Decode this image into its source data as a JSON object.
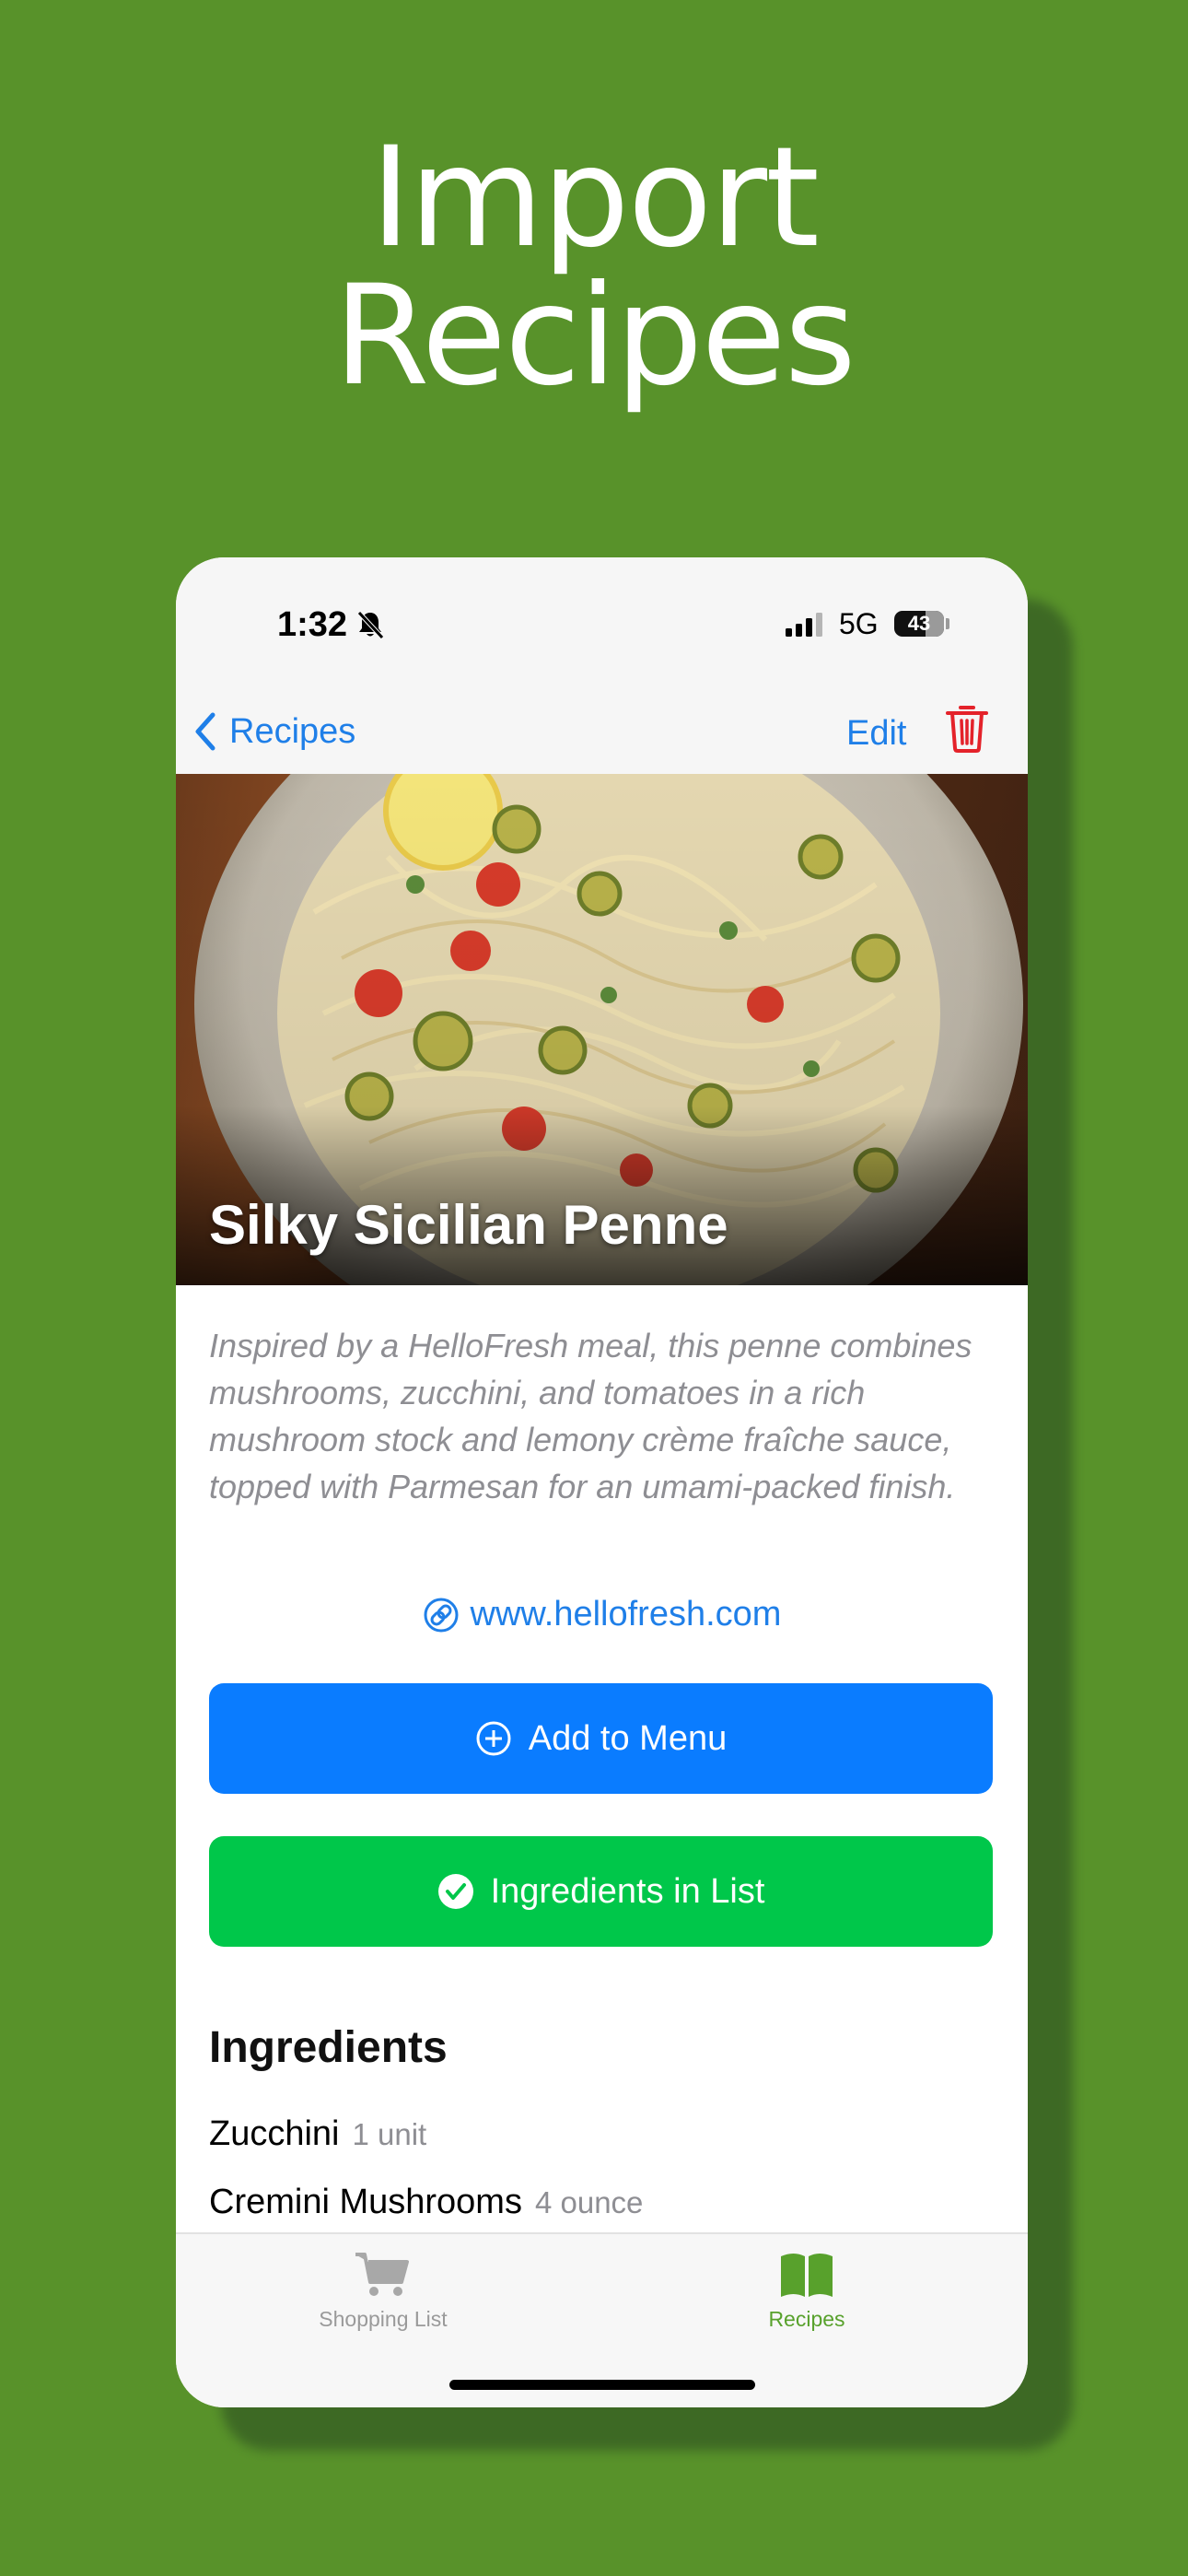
{
  "headline": {
    "line1": "Import",
    "line2": "Recipes"
  },
  "status": {
    "time": "1:32",
    "network": "5G",
    "battery": "43"
  },
  "nav": {
    "back_label": "Recipes",
    "edit_label": "Edit"
  },
  "recipe": {
    "title": "Silky Sicilian Penne",
    "description": "Inspired by a HelloFresh meal, this penne combines mushrooms, zucchini, and tomatoes in a rich mushroom stock and lemony crème fraîche sauce, topped with Parmesan for an umami-packed finish.",
    "source": "www.hellofresh.com"
  },
  "actions": {
    "add_label": "Add to Menu",
    "list_label": "Ingredients in List"
  },
  "ingredients": {
    "title": "Ingredients",
    "items": [
      {
        "name": "Zucchini",
        "qty": "1 unit"
      },
      {
        "name": "Cremini Mushrooms",
        "qty": "4 ounce"
      }
    ]
  },
  "tabs": [
    {
      "label": "Shopping List",
      "icon": "cart-icon",
      "active": false
    },
    {
      "label": "Recipes",
      "icon": "book-icon",
      "active": true
    }
  ],
  "colors": {
    "background": "#58922a",
    "accent_blue": "#0a7cff",
    "accent_green": "#00c74a",
    "tab_active": "#58a12c"
  }
}
